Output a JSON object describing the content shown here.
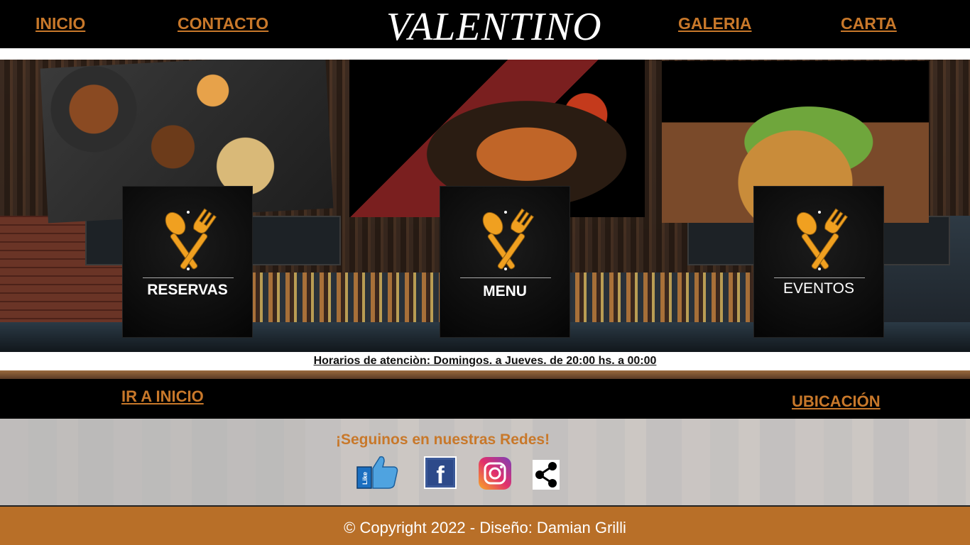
{
  "header": {
    "brand": "VALENTINO",
    "nav": {
      "inicio": "INICIO",
      "contacto": "CONTACTO",
      "galeria": "GALERIA",
      "carta": "CARTA"
    }
  },
  "hero": {
    "cards": [
      {
        "label": "RESERVAS",
        "icon": "spoon-fork-icon"
      },
      {
        "label": "MENU",
        "icon": "spoon-fork-icon"
      },
      {
        "label": "EVENTOS",
        "icon": "spoon-fork-icon"
      }
    ]
  },
  "hours": {
    "text": "Horarios de atenciòn: Domingos. a Jueves. de 20:00 hs. a 00:00"
  },
  "links": {
    "ir_a_inicio": "IR A INICIO",
    "ubicacion": "UBICACIÓN"
  },
  "social": {
    "title": "¡Seguinos en nuestras Redes!",
    "like_text": "Like",
    "facebook_letter": "f",
    "icons": [
      "like-icon",
      "facebook-icon",
      "instagram-icon",
      "share-icon"
    ]
  },
  "footer": {
    "text": "© Copyright 2022 - Diseño: Damian Grilli"
  },
  "colors": {
    "accent": "#c8782a",
    "footer": "#b86f28",
    "header": "#000000"
  }
}
